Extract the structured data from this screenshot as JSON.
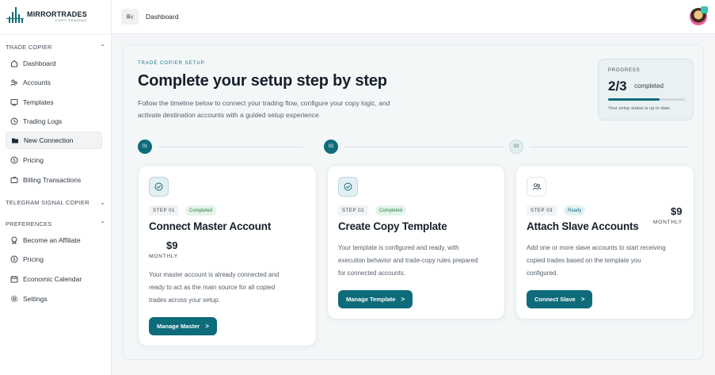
{
  "brand": {
    "name": "MIRRORTRADES",
    "tagline": "COPY TRADING"
  },
  "sidebar": {
    "sections": [
      {
        "title": "TRADE COPIER",
        "chevron": "^",
        "items": [
          {
            "label": "Dashboard",
            "icon": "home-icon"
          },
          {
            "label": "Accounts",
            "icon": "users-icon"
          },
          {
            "label": "Templates",
            "icon": "monitor-icon"
          },
          {
            "label": "Trading Logs",
            "icon": "clock-icon"
          },
          {
            "label": "New Connection",
            "icon": "folder-icon",
            "active": true
          },
          {
            "label": "Pricing",
            "icon": "dollar-icon"
          },
          {
            "label": "Billing Transactions",
            "icon": "wallet-icon"
          }
        ]
      },
      {
        "title": "TELEGRAM SIGNAL COPIER",
        "chevron": "v",
        "items": []
      },
      {
        "title": "PREFERENCES",
        "chevron": "^",
        "items": [
          {
            "label": "Become an Affiliate",
            "icon": "badge-icon"
          },
          {
            "label": "Pricing",
            "icon": "dollar-icon"
          },
          {
            "label": "Economic Calendar",
            "icon": "calendar-icon"
          },
          {
            "label": "Settings",
            "icon": "gear-icon"
          }
        ]
      }
    ]
  },
  "topbar": {
    "title": "Dashboard"
  },
  "setup": {
    "eyebrow": "TRADE COPIER SETUP",
    "headline": "Complete your setup step by step",
    "description": "Follow the timeline below to connect your trading flow, configure your copy logic, and activate destination accounts with a guided setup experience."
  },
  "progress": {
    "label": "PROGRESS",
    "value": "2/3",
    "word": "completed",
    "fraction": 0.667,
    "note": "Your setup status is up to date."
  },
  "steps": [
    {
      "node": "01",
      "step": "STEP 01",
      "status": "Completed",
      "status_kind": "green",
      "title": "Connect Master Account",
      "price": "$9",
      "per": "MONTHLY",
      "description": [
        "Your master account is already connected and",
        "ready to act as the main source for all copied",
        "trades across your setup."
      ],
      "button": "Manage Master",
      "icon": "check-circle-icon"
    },
    {
      "node": "02",
      "step": "STEP 02",
      "status": "Completed",
      "status_kind": "green",
      "title": "Create Copy Template",
      "description": [
        "Your template is configured and ready, with",
        "execution behavior and trade-copy rules prepared",
        "for connected accounts."
      ],
      "button": "Manage Template",
      "icon": "check-circle-icon"
    },
    {
      "node": "03",
      "step": "STEP 03",
      "status": "Ready",
      "status_kind": "blue",
      "title": "Attach Slave Accounts",
      "price": "$9",
      "per": "MONTHLY",
      "description": [
        "Add one or more slave accounts to start receiving",
        "copied trades based on the template you",
        "configured."
      ],
      "button": "Connect Slave",
      "icon": "users-icon"
    }
  ],
  "arrow": ">",
  "colors": {
    "accent": "#0e6b7a",
    "completed_bg": "#e3f4ea",
    "ready_bg": "#e4f1f4"
  }
}
